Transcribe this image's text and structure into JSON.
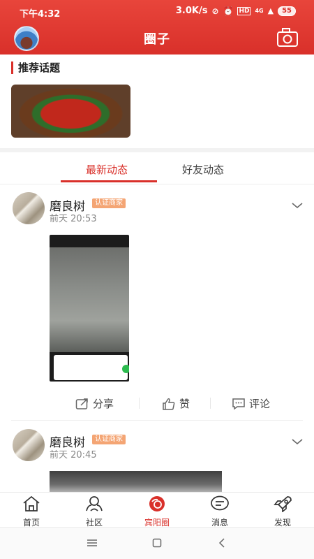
{
  "status_bar": {
    "time": "下午4:32",
    "network_speed": "3.0K/s",
    "battery": "55",
    "signal": "4G"
  },
  "header": {
    "title": "圈子"
  },
  "recommended": {
    "title": "推荐话题"
  },
  "tabs": [
    {
      "label": "最新动态",
      "active": true
    },
    {
      "label": "好友动态",
      "active": false
    }
  ],
  "posts": [
    {
      "name": "磨良树",
      "badge": "认证商家",
      "time": "前天 20:53"
    },
    {
      "name": "磨良树",
      "badge": "认证商家",
      "time": "前天 20:45"
    }
  ],
  "actions": {
    "share": "分享",
    "like": "赞",
    "comment": "评论"
  },
  "bottom_nav": [
    {
      "label": "首页",
      "icon": "home-icon"
    },
    {
      "label": "社区",
      "icon": "community-icon"
    },
    {
      "label": "宾阳圈",
      "icon": "circle-icon",
      "active": true
    },
    {
      "label": "消息",
      "icon": "message-icon"
    },
    {
      "label": "发现",
      "icon": "rocket-icon"
    }
  ],
  "colors": {
    "accent": "#d9302a",
    "badge": "#f4a574"
  }
}
